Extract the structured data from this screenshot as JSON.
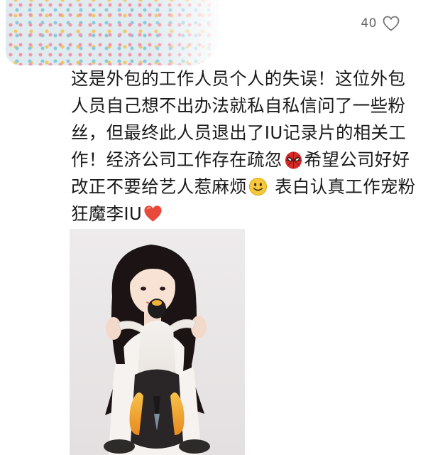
{
  "header": {
    "avatar_mosaic": "blurred-username-mosaic"
  },
  "like": {
    "count": "40",
    "icon": "heart-outline-icon"
  },
  "comment": {
    "segments": [
      "这是外包的工作人员个人的失误！这位外包人员自己想不出办法就私自私信问了一些粉丝，但最终此人员退出了IU记录片的相关工作！经济公司工作存在疏忽",
      "希望公司好好改正不要给艺人惹麻烦",
      " 表白认真工作宠粉狂魔李IU"
    ],
    "emojis": [
      "spider-mask-emoji",
      "smile-emoji",
      "heart-emoji"
    ]
  },
  "photo": {
    "description_icon": "photo-woman-with-penguin-plush"
  },
  "colors": {
    "text": "#1a1a1a",
    "meta": "#666666",
    "heart": "#e8493a"
  }
}
